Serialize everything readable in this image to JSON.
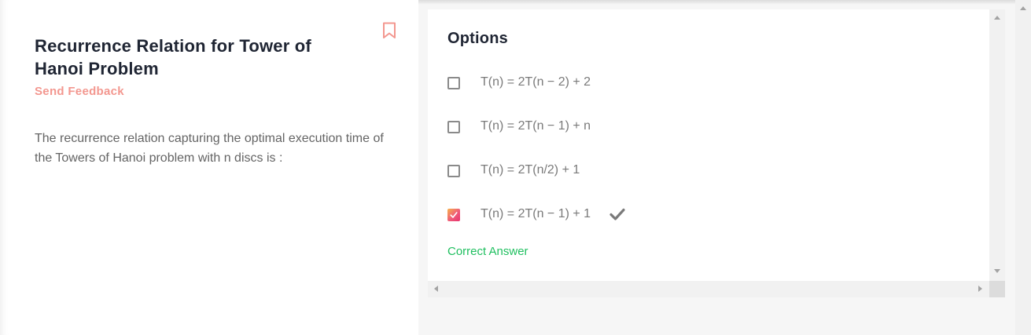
{
  "question": {
    "title": "Recurrence Relation for Tower of Hanoi Problem",
    "feedback_label": "Send Feedback",
    "body": "The recurrence relation capturing the optimal execution time of the Towers of Hanoi problem with n discs is :",
    "bookmark_icon": "bookmark-icon"
  },
  "options": {
    "heading": "Options",
    "items": [
      {
        "text": "T(n) = 2T(n − 2) + 2",
        "checked": false
      },
      {
        "text": "T(n) = 2T(n − 1) + n",
        "checked": false
      },
      {
        "text": "T(n) = 2T(n/2) + 1",
        "checked": false
      },
      {
        "text": "T(n) = 2T(n − 1) + 1",
        "checked": true,
        "correct": true
      }
    ],
    "correct_label": "Correct Answer"
  },
  "colors": {
    "accent": "#f3978f",
    "correct": "#1fbf5f",
    "title": "#1f2533",
    "body_text": "#646464"
  }
}
